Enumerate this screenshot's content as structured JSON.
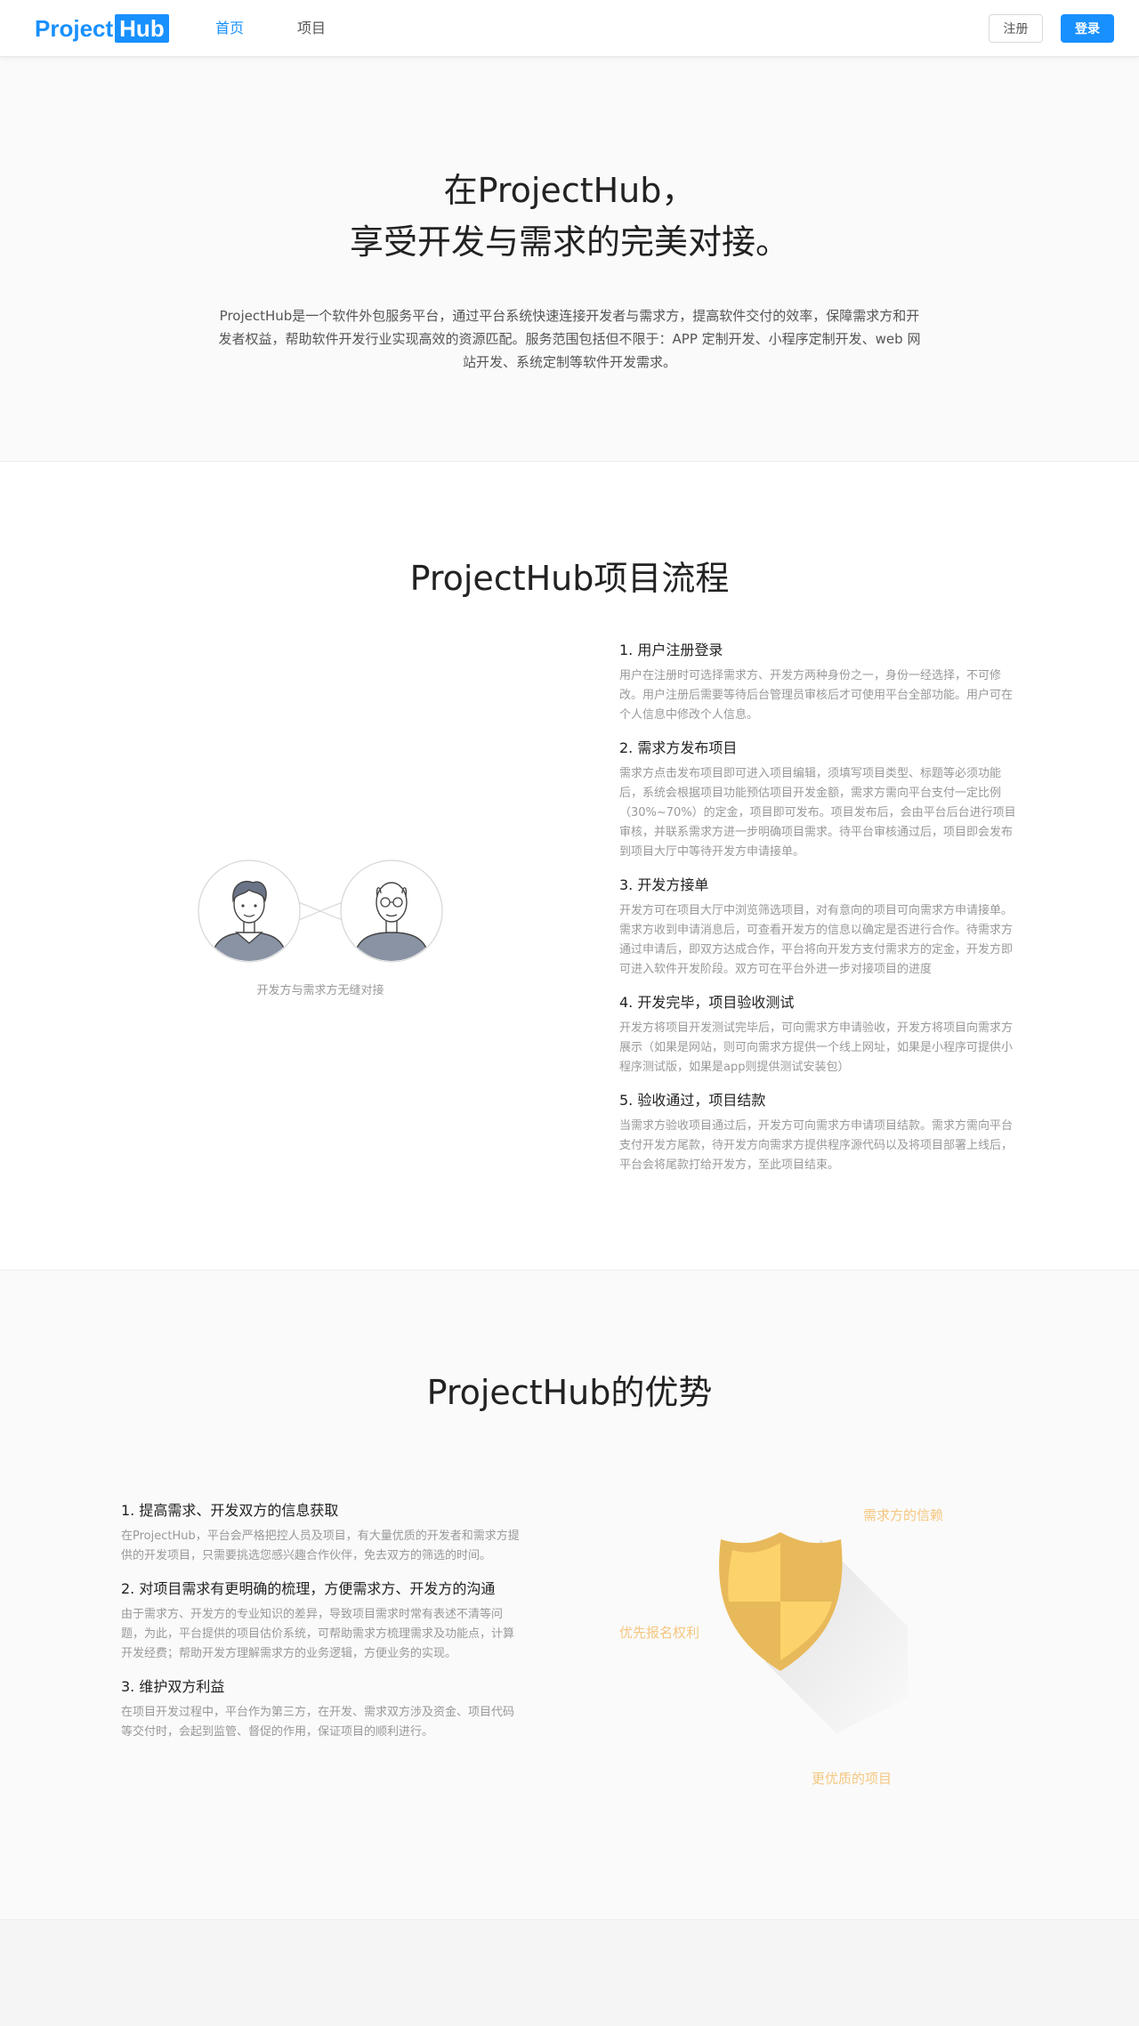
{
  "header": {
    "logo_part1": "Project",
    "logo_part2": "Hub",
    "nav": [
      {
        "label": "首页",
        "active": true
      },
      {
        "label": "项目",
        "active": false
      }
    ],
    "register_label": "注册",
    "login_label": "登录",
    "accent_color": "#1890ff"
  },
  "hero": {
    "title_line1": "在ProjectHub，",
    "title_line2": "享受开发与需求的完美对接。",
    "description": "ProjectHub是一个软件外包服务平台，通过平台系统快速连接开发者与需求方，提高软件交付的效率，保障需求方和开发者权益，帮助软件开发行业实现高效的资源匹配。服务范围包括但不限于：APP 定制开发、小程序定制开发、web 网站开发、系统定制等软件开发需求。"
  },
  "process": {
    "title": "ProjectHub项目流程",
    "illustration_caption": "开发方与需求方无缝对接",
    "steps": [
      {
        "title": "1. 用户注册登录",
        "desc": "用户在注册时可选择需求方、开发方两种身份之一，身份一经选择，不可修改。用户注册后需要等待后台管理员审核后才可使用平台全部功能。用户可在个人信息中修改个人信息。"
      },
      {
        "title": "2. 需求方发布项目",
        "desc": "需求方点击发布项目即可进入项目编辑，须填写项目类型、标题等必须功能后，系统会根据项目功能预估项目开发金额，需求方需向平台支付一定比例（30%~70%）的定金，项目即可发布。项目发布后，会由平台后台进行项目审核，并联系需求方进一步明确项目需求。待平台审核通过后，项目即会发布到项目大厅中等待开发方申请接单。"
      },
      {
        "title": "3. 开发方接单",
        "desc": "开发方可在项目大厅中浏览筛选项目，对有意向的项目可向需求方申请接单。需求方收到申请消息后，可查看开发方的信息以确定是否进行合作。待需求方通过申请后，即双方达成合作，平台将向开发方支付需求方的定金，开发方即可进入软件开发阶段。双方可在平台外进一步对接项目的进度"
      },
      {
        "title": "4. 开发完毕，项目验收测试",
        "desc": "开发方将项目开发测试完毕后，可向需求方申请验收，开发方将项目向需求方展示（如果是网站，则可向需求方提供一个线上网址，如果是小程序可提供小程序测试版，如果是app则提供测试安装包）"
      },
      {
        "title": "5. 验收通过，项目结款",
        "desc": "当需求方验收项目通过后，开发方可向需求方申请项目结款。需求方需向平台支付开发方尾款，待开发方向需求方提供程序源代码以及将项目部署上线后，平台会将尾款打给开发方，至此项目结束。"
      }
    ]
  },
  "advantages": {
    "title": "ProjectHub的优势",
    "items": [
      {
        "title": "1. 提高需求、开发双方的信息获取",
        "desc": "在ProjectHub，平台会严格把控人员及项目，有大量优质的开发者和需求方提供的开发项目，只需要挑选您感兴趣合作伙伴，免去双方的筛选的时间。"
      },
      {
        "title": "2. 对项目需求有更明确的梳理，方便需求方、开发方的沟通",
        "desc": "由于需求方、开发方的专业知识的差异，导致项目需求时常有表述不清等问题，为此，平台提供的项目估价系统，可帮助需求方梳理需求及功能点，计算开发经费；帮助开发方理解需求方的业务逻辑，方便业务的实现。"
      },
      {
        "title": "3. 维护双方利益",
        "desc": "在项目开发过程中，平台作为第三方，在开发、需求双方涉及资金、项目代码等交付时，会起到监管、督促的作用，保证项目的顺利进行。"
      }
    ],
    "shield_labels": [
      "需求方的信赖",
      "优先报名权利",
      "更优质的项目"
    ],
    "shield_colors": {
      "light": "#fcd26b",
      "dark": "#e8b95a",
      "label": "#f5c780"
    }
  }
}
